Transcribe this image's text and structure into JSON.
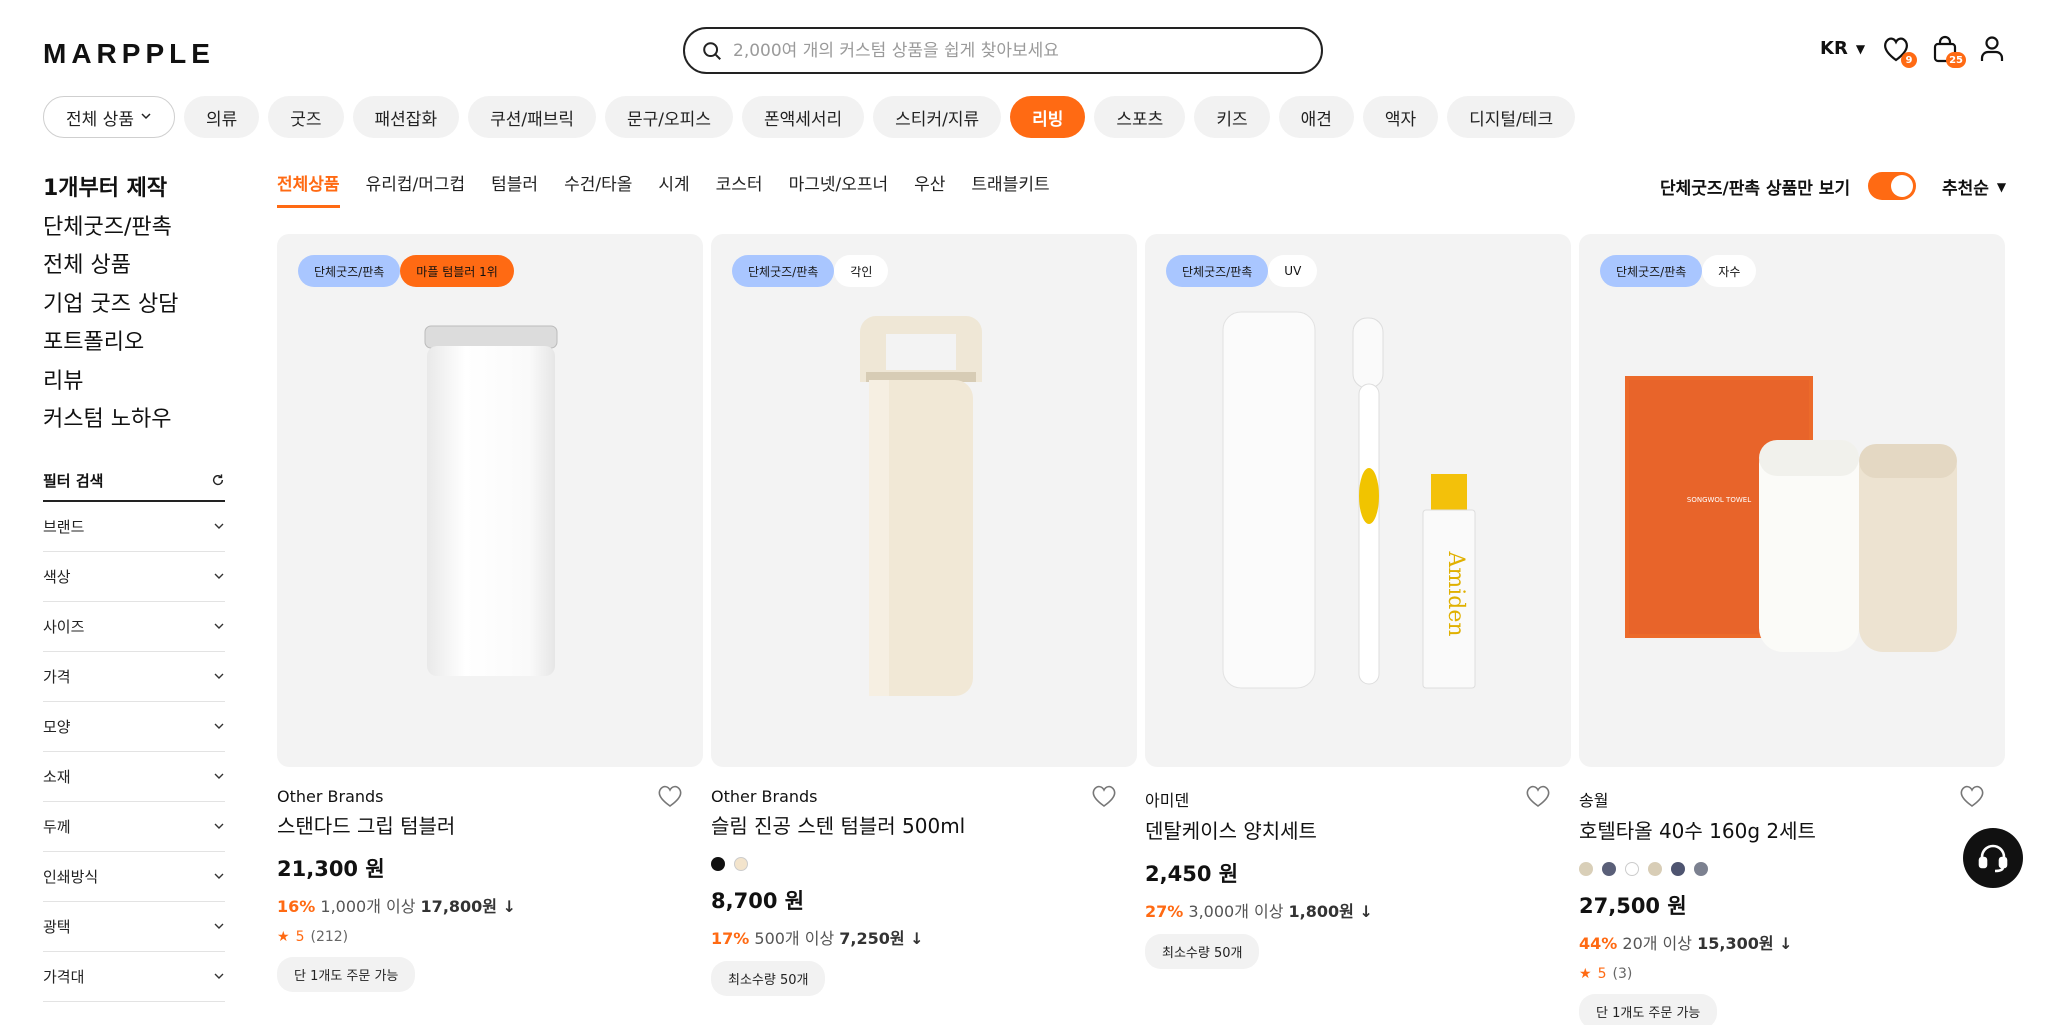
{
  "header": {
    "logo": "MARPPLE",
    "search_placeholder": "2,000여 개의 커스텀 상품을 쉽게 찾아보세요",
    "lang": "KR",
    "wishlist_count": "9",
    "cart_count": "25"
  },
  "categories": [
    {
      "label": "전체 상품",
      "style": "outline"
    },
    {
      "label": "의류"
    },
    {
      "label": "굿즈"
    },
    {
      "label": "패션잡화"
    },
    {
      "label": "쿠션/패브릭"
    },
    {
      "label": "문구/오피스"
    },
    {
      "label": "폰액세서리"
    },
    {
      "label": "스티커/지류"
    },
    {
      "label": "리빙",
      "style": "active"
    },
    {
      "label": "스포츠"
    },
    {
      "label": "키즈"
    },
    {
      "label": "애견"
    },
    {
      "label": "액자"
    },
    {
      "label": "디지털/테크"
    }
  ],
  "sidebar": {
    "links": [
      "1개부터 제작",
      "단체굿즈/판촉",
      "전체 상품",
      "기업 굿즈 상담",
      "포트폴리오",
      "리뷰",
      "커스텀 노하우"
    ],
    "filter_title": "필터 검색",
    "filters": [
      "브랜드",
      "색상",
      "사이즈",
      "가격",
      "모양",
      "소재",
      "두께",
      "인쇄방식",
      "광택",
      "가격대"
    ]
  },
  "subtabs": [
    "전체상품",
    "유리컵/머그컵",
    "텀블러",
    "수건/타올",
    "시계",
    "코스터",
    "마그넷/오프너",
    "우산",
    "트래블키트"
  ],
  "only_group_label": "단체굿즈/판촉 상품만 보기",
  "sort_label": "추천순",
  "products": [
    {
      "tags": [
        {
          "text": "단체굿즈/판촉",
          "style": "blue"
        },
        {
          "text": "마플 텀블러 1위",
          "style": "orange"
        }
      ],
      "brand": "Other Brands",
      "name": "스탠다드 그립 텀블러",
      "swatches": [],
      "price": "21,300 원",
      "discount_pct": "16%",
      "discount_qty": "1,000개 이상",
      "discount_price": "17,800원 ↓",
      "rating_score": "5",
      "rating_count": "(212)",
      "pill": "단 1개도 주문 가능"
    },
    {
      "tags": [
        {
          "text": "단체굿즈/판촉",
          "style": "blue"
        },
        {
          "text": "각인",
          "style": "white"
        }
      ],
      "brand": "Other Brands",
      "name": "슬림 진공 스텐 텀블러 500ml",
      "swatches": [
        "#111111",
        "#f3e4cc"
      ],
      "price": "8,700 원",
      "discount_pct": "17%",
      "discount_qty": "500개 이상",
      "discount_price": "7,250원 ↓",
      "rating_score": "",
      "rating_count": "",
      "pill": "최소수량 50개"
    },
    {
      "tags": [
        {
          "text": "단체굿즈/판촉",
          "style": "blue"
        },
        {
          "text": "UV",
          "style": "white"
        }
      ],
      "brand": "아미덴",
      "name": "덴탈케이스 양치세트",
      "swatches": [],
      "price": "2,450 원",
      "discount_pct": "27%",
      "discount_qty": "3,000개 이상",
      "discount_price": "1,800원 ↓",
      "rating_score": "",
      "rating_count": "",
      "pill": "최소수량 50개"
    },
    {
      "tags": [
        {
          "text": "단체굿즈/판촉",
          "style": "blue"
        },
        {
          "text": "자수",
          "style": "white"
        }
      ],
      "brand": "송월",
      "name": "호텔타올 40수 160g 2세트",
      "swatches": [
        "#d9cfb8",
        "#5a5f78",
        "#ffffff",
        "#d8cdb6",
        "#4e5470",
        "#7c8190"
      ],
      "price": "27,500 원",
      "discount_pct": "44%",
      "discount_qty": "20개 이상",
      "discount_price": "15,300원 ↓",
      "rating_score": "5",
      "rating_count": "(3)",
      "pill": "단 1개도 주문 가능"
    }
  ],
  "colors": {
    "accent": "#ff6a13",
    "tag_blue": "#a9c6ff",
    "card_bg": "#f3f3f3"
  }
}
